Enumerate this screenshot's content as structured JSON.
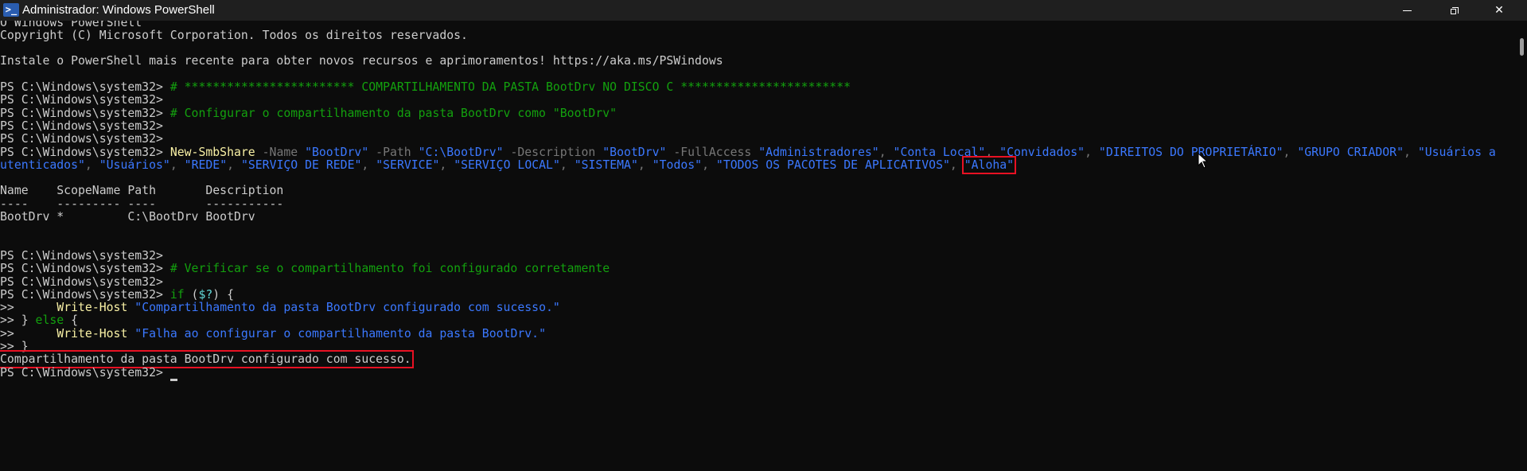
{
  "window": {
    "title": "Administrador: Windows PowerShell",
    "app_icon_glyph": ">_",
    "controls": [
      "minimize",
      "maximize",
      "close"
    ],
    "close_glyph": "✕"
  },
  "colors": {
    "background": "#0c0c0c",
    "titlebar": "#1f1f1f",
    "text": "#cccccc",
    "comment": "#13a10e",
    "command": "#f9f1a5",
    "parameter": "#767676",
    "string": "#3b78ff",
    "highlight_box": "#e81123"
  },
  "console": {
    "lines": [
      [
        {
          "t": "O Windows PowerShell",
          "c": "txt"
        }
      ],
      [
        {
          "t": "Copyright (C) Microsoft Corporation. Todos os direitos reservados.",
          "c": "txt"
        }
      ],
      [],
      [
        {
          "t": "Instale o PowerShell mais recente para obter novos recursos e aprimoramentos! https://aka.ms/PSWindows",
          "c": "txt"
        }
      ],
      [],
      [
        {
          "t": "PS C:\\Windows\\system32> ",
          "c": "txt"
        },
        {
          "t": "# ************************ COMPARTILHAMENTO DA PASTA BootDrv NO DISCO C ************************",
          "c": "cmt"
        }
      ],
      [
        {
          "t": "PS C:\\Windows\\system32>",
          "c": "txt"
        }
      ],
      [
        {
          "t": "PS C:\\Windows\\system32> ",
          "c": "txt"
        },
        {
          "t": "# Configurar o compartilhamento da pasta BootDrv como \"BootDrv\"",
          "c": "cmt"
        }
      ],
      [
        {
          "t": "PS C:\\Windows\\system32>",
          "c": "txt"
        }
      ],
      [
        {
          "t": "PS C:\\Windows\\system32>",
          "c": "txt"
        }
      ],
      [
        {
          "t": "PS C:\\Windows\\system32> ",
          "c": "txt"
        },
        {
          "t": "New-SmbShare",
          "c": "cmd"
        },
        {
          "t": " -Name ",
          "c": "param"
        },
        {
          "t": "\"BootDrv\"",
          "c": "str"
        },
        {
          "t": " -Path ",
          "c": "param"
        },
        {
          "t": "\"C:\\BootDrv\"",
          "c": "str"
        },
        {
          "t": " -Description ",
          "c": "param"
        },
        {
          "t": "\"BootDrv\"",
          "c": "str"
        },
        {
          "t": " -FullAccess ",
          "c": "param"
        },
        {
          "t": "\"Administradores\"",
          "c": "str"
        },
        {
          "t": ", ",
          "c": "param"
        },
        {
          "t": "\"Conta Local\"",
          "c": "str"
        },
        {
          "t": ", ",
          "c": "param"
        },
        {
          "t": "\"Convidados\"",
          "c": "str"
        },
        {
          "t": ", ",
          "c": "param"
        },
        {
          "t": "\"DIREITOS DO PROPRIETÁRIO\"",
          "c": "str"
        },
        {
          "t": ", ",
          "c": "param"
        },
        {
          "t": "\"GRUPO CRIADOR\"",
          "c": "str"
        },
        {
          "t": ", ",
          "c": "param"
        },
        {
          "t": "\"Usuários a",
          "c": "str"
        }
      ],
      [
        {
          "t": "utenticados\"",
          "c": "str"
        },
        {
          "t": ", ",
          "c": "param"
        },
        {
          "t": "\"Usuários\"",
          "c": "str"
        },
        {
          "t": ", ",
          "c": "param"
        },
        {
          "t": "\"REDE\"",
          "c": "str"
        },
        {
          "t": ", ",
          "c": "param"
        },
        {
          "t": "\"SERVIÇO DE REDE\"",
          "c": "str"
        },
        {
          "t": ", ",
          "c": "param"
        },
        {
          "t": "\"SERVICE\"",
          "c": "str"
        },
        {
          "t": ", ",
          "c": "param"
        },
        {
          "t": "\"SERVIÇO LOCAL\"",
          "c": "str"
        },
        {
          "t": ", ",
          "c": "param"
        },
        {
          "t": "\"SISTEMA\"",
          "c": "str"
        },
        {
          "t": ", ",
          "c": "param"
        },
        {
          "t": "\"Todos\"",
          "c": "str"
        },
        {
          "t": ", ",
          "c": "param"
        },
        {
          "t": "\"TODOS OS PACOTES DE APLICATIVOS\"",
          "c": "str"
        },
        {
          "t": ", ",
          "c": "param"
        },
        {
          "t": "\"Aloha\"",
          "c": "str",
          "hl": true
        }
      ],
      [],
      [
        {
          "t": "Name    ScopeName Path       Description",
          "c": "txt"
        }
      ],
      [
        {
          "t": "----    --------- ----       -----------",
          "c": "txt"
        }
      ],
      [
        {
          "t": "BootDrv *         C:\\BootDrv BootDrv",
          "c": "txt"
        }
      ],
      [],
      [],
      [
        {
          "t": "PS C:\\Windows\\system32>",
          "c": "txt"
        }
      ],
      [
        {
          "t": "PS C:\\Windows\\system32> ",
          "c": "txt"
        },
        {
          "t": "# Verificar se o compartilhamento foi configurado corretamente",
          "c": "cmt"
        }
      ],
      [
        {
          "t": "PS C:\\Windows\\system32>",
          "c": "txt"
        }
      ],
      [
        {
          "t": "PS C:\\Windows\\system32> ",
          "c": "txt"
        },
        {
          "t": "if",
          "c": "kw"
        },
        {
          "t": " (",
          "c": "txt"
        },
        {
          "t": "$?",
          "c": "var"
        },
        {
          "t": ") {",
          "c": "txt"
        }
      ],
      [
        {
          "t": ">>      ",
          "c": "txt"
        },
        {
          "t": "Write-Host",
          "c": "cmd"
        },
        {
          "t": " ",
          "c": "txt"
        },
        {
          "t": "\"Compartilhamento da pasta BootDrv configurado com sucesso.\"",
          "c": "str"
        }
      ],
      [
        {
          "t": ">> } ",
          "c": "txt"
        },
        {
          "t": "else",
          "c": "kw"
        },
        {
          "t": " {",
          "c": "txt"
        }
      ],
      [
        {
          "t": ">>      ",
          "c": "txt"
        },
        {
          "t": "Write-Host",
          "c": "cmd"
        },
        {
          "t": " ",
          "c": "txt"
        },
        {
          "t": "\"Falha ao configurar o compartilhamento da pasta BootDrv.\"",
          "c": "str"
        }
      ],
      [
        {
          "t": ">> }",
          "c": "txt"
        }
      ],
      [
        {
          "t": "Compartilhamento da pasta BootDrv configurado com sucesso.",
          "c": "txt",
          "hl": true
        }
      ],
      [
        {
          "t": "PS C:\\Windows\\system32> ",
          "c": "txt"
        },
        {
          "cursor": true
        }
      ]
    ]
  }
}
